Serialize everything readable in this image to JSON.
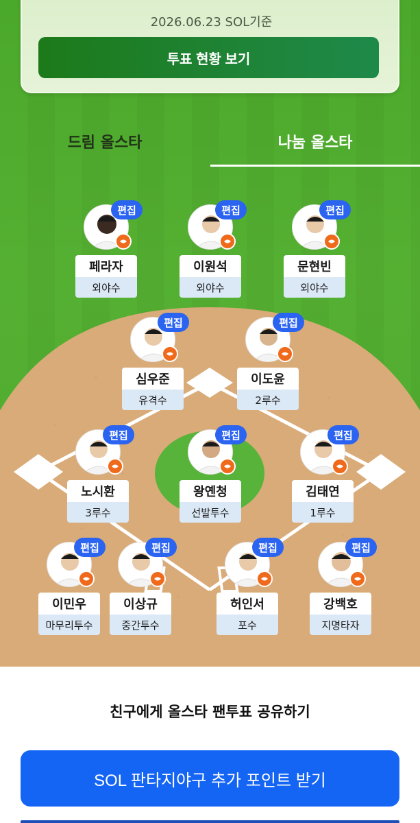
{
  "vote_card": {
    "date": "2026.06.23 SOL기준",
    "button_label": "투표 현황 보기"
  },
  "tabs": [
    {
      "label": "드림 올스타",
      "active": false
    },
    {
      "label": "나눔 올스타",
      "active": true
    }
  ],
  "edit_label": "편집",
  "players": [
    {
      "name": "페라자",
      "position": "외야수"
    },
    {
      "name": "이원석",
      "position": "외야수"
    },
    {
      "name": "문현빈",
      "position": "외야수"
    },
    {
      "name": "심우준",
      "position": "유격수"
    },
    {
      "name": "이도윤",
      "position": "2루수"
    },
    {
      "name": "노시환",
      "position": "3루수"
    },
    {
      "name": "왕옌청",
      "position": "선발투수"
    },
    {
      "name": "김태연",
      "position": "1루수"
    },
    {
      "name": "이민우",
      "position": "마무리투수"
    },
    {
      "name": "이상규",
      "position": "중간투수"
    },
    {
      "name": "허인서",
      "position": "포수"
    },
    {
      "name": "강백호",
      "position": "지명타자"
    }
  ],
  "share_text": "친구에게 올스타 팬투표 공유하기",
  "point_button_label": "SOL 판타지야구 추가 포인트 받기",
  "colors": {
    "field_green": "#4aa82a",
    "infield_dirt": "#d9ab78",
    "edit_badge": "#2b64f0",
    "team_badge": "#f06a1c",
    "primary_button": "#1565f5",
    "vote_button": "#1d7a1a"
  }
}
